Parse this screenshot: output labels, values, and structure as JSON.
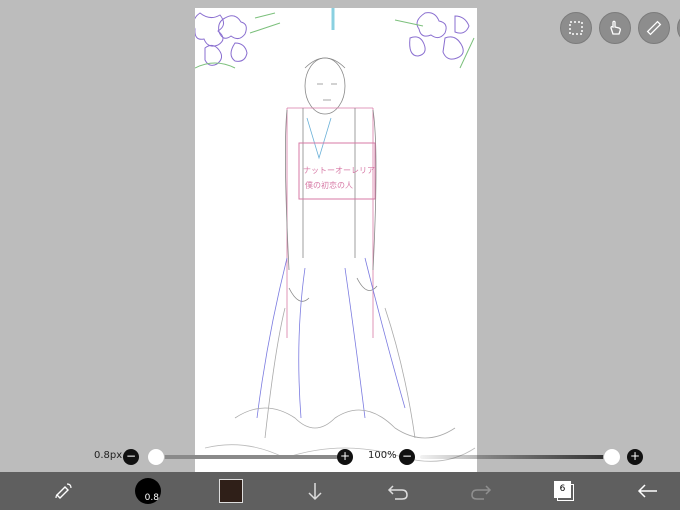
{
  "top_tools": [
    {
      "name": "selection",
      "icon": "dashed-selection-icon"
    },
    {
      "name": "hand",
      "icon": "hand-pointer-icon"
    },
    {
      "name": "ruler",
      "icon": "ruler-icon"
    }
  ],
  "brush_size": {
    "label": "0.8px",
    "minus": "−",
    "plus": "+",
    "level": 0.0
  },
  "opacity": {
    "label": "100%",
    "minus": "−",
    "plus": "+",
    "level": 1.0
  },
  "bottom_bar": {
    "brush_size_badge": "0.8",
    "color_swatch": "#2f1f18",
    "layer_count": "6",
    "icons": [
      "brush-eraser-swap-icon",
      "brush-size-icon",
      "color-swatch-icon",
      "download-arrow-icon",
      "undo-icon",
      "redo-icon",
      "layers-icon",
      "back-arrow-icon"
    ]
  },
  "canvas_text": {
    "line1": "ナットーオーレリア",
    "line2": "僕の初恋の人"
  },
  "colors": {
    "toolbar": "#5f5f5f",
    "workspace": "#bcbcbc",
    "sketch_pink": "#d77aa6",
    "sketch_blue": "#7b7be0"
  }
}
